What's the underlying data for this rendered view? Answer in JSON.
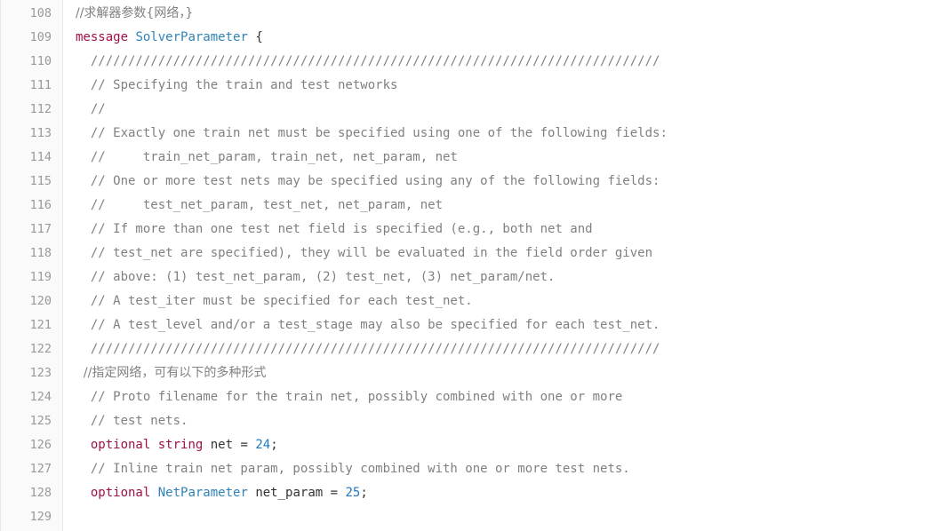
{
  "colors": {
    "comment": "#808080",
    "keyword": "#a0104b",
    "type": "#2f83b6",
    "number": "#1e77c2",
    "plain": "#333333",
    "line_number": "#999999",
    "gutter_bg": "#fafafa"
  },
  "lines": [
    {
      "n": "108",
      "tokens": [
        {
          "t": "comment",
          "v": "//求解器参数{网络，}"
        }
      ]
    },
    {
      "n": "109",
      "tokens": [
        {
          "t": "keyword",
          "v": "message"
        },
        {
          "t": "plain",
          "v": " "
        },
        {
          "t": "type",
          "v": "SolverParameter"
        },
        {
          "t": "plain",
          "v": " {"
        }
      ]
    },
    {
      "n": "110",
      "tokens": [
        {
          "t": "comment",
          "v": "  ////////////////////////////////////////////////////////////////////////////"
        }
      ]
    },
    {
      "n": "111",
      "tokens": [
        {
          "t": "comment",
          "v": "  // Specifying the train and test networks"
        }
      ]
    },
    {
      "n": "112",
      "tokens": [
        {
          "t": "comment",
          "v": "  //"
        }
      ]
    },
    {
      "n": "113",
      "tokens": [
        {
          "t": "comment",
          "v": "  // Exactly one train net must be specified using one of the following fields:"
        }
      ]
    },
    {
      "n": "114",
      "tokens": [
        {
          "t": "comment",
          "v": "  //     train_net_param, train_net, net_param, net"
        }
      ]
    },
    {
      "n": "115",
      "tokens": [
        {
          "t": "comment",
          "v": "  // One or more test nets may be specified using any of the following fields:"
        }
      ]
    },
    {
      "n": "116",
      "tokens": [
        {
          "t": "comment",
          "v": "  //     test_net_param, test_net, net_param, net"
        }
      ]
    },
    {
      "n": "117",
      "tokens": [
        {
          "t": "comment",
          "v": "  // If more than one test net field is specified (e.g., both net and"
        }
      ]
    },
    {
      "n": "118",
      "tokens": [
        {
          "t": "comment",
          "v": "  // test_net are specified), they will be evaluated in the field order given"
        }
      ]
    },
    {
      "n": "119",
      "tokens": [
        {
          "t": "comment",
          "v": "  // above: (1) test_net_param, (2) test_net, (3) net_param/net."
        }
      ]
    },
    {
      "n": "120",
      "tokens": [
        {
          "t": "comment",
          "v": "  // A test_iter must be specified for each test_net."
        }
      ]
    },
    {
      "n": "121",
      "tokens": [
        {
          "t": "comment",
          "v": "  // A test_level and/or a test_stage may also be specified for each test_net."
        }
      ]
    },
    {
      "n": "122",
      "tokens": [
        {
          "t": "comment",
          "v": "  ////////////////////////////////////////////////////////////////////////////"
        }
      ]
    },
    {
      "n": "123",
      "tokens": [
        {
          "t": "comment",
          "v": "  //指定网络，可有以下的多种形式"
        }
      ]
    },
    {
      "n": "124",
      "tokens": [
        {
          "t": "comment",
          "v": "  // Proto filename for the train net, possibly combined with one or more"
        }
      ]
    },
    {
      "n": "125",
      "tokens": [
        {
          "t": "comment",
          "v": "  // test nets."
        }
      ]
    },
    {
      "n": "126",
      "tokens": [
        {
          "t": "plain",
          "v": "  "
        },
        {
          "t": "keyword",
          "v": "optional"
        },
        {
          "t": "plain",
          "v": " "
        },
        {
          "t": "keyword",
          "v": "string"
        },
        {
          "t": "plain",
          "v": " net = "
        },
        {
          "t": "number",
          "v": "24"
        },
        {
          "t": "plain",
          "v": ";"
        }
      ]
    },
    {
      "n": "127",
      "tokens": [
        {
          "t": "comment",
          "v": "  // Inline train net param, possibly combined with one or more test nets."
        }
      ]
    },
    {
      "n": "128",
      "tokens": [
        {
          "t": "plain",
          "v": "  "
        },
        {
          "t": "keyword",
          "v": "optional"
        },
        {
          "t": "plain",
          "v": " "
        },
        {
          "t": "type",
          "v": "NetParameter"
        },
        {
          "t": "plain",
          "v": " net_param = "
        },
        {
          "t": "number",
          "v": "25"
        },
        {
          "t": "plain",
          "v": ";"
        }
      ]
    },
    {
      "n": "129",
      "tokens": []
    }
  ]
}
